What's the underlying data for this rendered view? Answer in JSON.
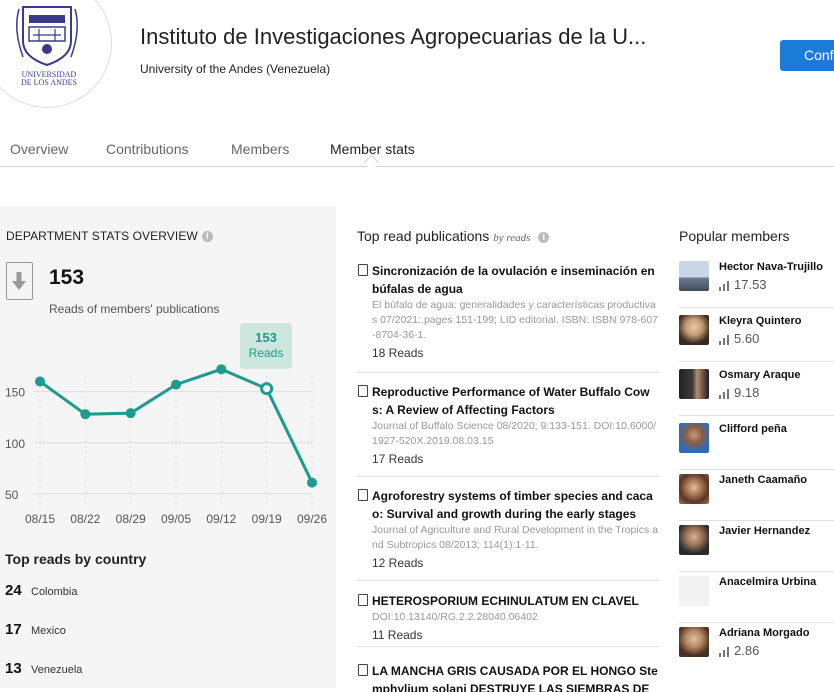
{
  "header": {
    "logo_text": "UNIVERSIDAD DE LOS ANDES",
    "title": "Instituto de Investigaciones Agropecuarias de la U...",
    "subtitle": "University of the Andes (Venezuela)",
    "follow_label": "Conf"
  },
  "tabs": [
    {
      "label": "Overview"
    },
    {
      "label": "Contributions"
    },
    {
      "label": "Members"
    },
    {
      "label": "Member stats"
    }
  ],
  "stats": {
    "section_label": "DEPARTMENT STATS OVERVIEW",
    "reads_value": "153",
    "reads_caption": "Reads of members' publications",
    "tooltip_value": "153",
    "tooltip_label": "Reads"
  },
  "chart_data": {
    "type": "line",
    "x": [
      "08/15",
      "08/22",
      "08/29",
      "09/05",
      "09/12",
      "09/19",
      "09/26"
    ],
    "values": [
      160,
      128,
      129,
      157,
      172,
      153,
      61
    ],
    "ylim": [
      40,
      185
    ],
    "yticks": [
      50,
      100,
      150
    ],
    "highlight_index": 5,
    "color": "#1b9c8d"
  },
  "countries": {
    "title": "Top reads by country",
    "items": [
      {
        "count": "24",
        "name": "Colombia"
      },
      {
        "count": "17",
        "name": "Mexico"
      },
      {
        "count": "13",
        "name": "Venezuela"
      }
    ]
  },
  "publications": {
    "title": "Top read publications",
    "by": "by reads",
    "items": [
      {
        "title": "Sincronización de la ovulación e inseminación en búfalas de agua",
        "meta": "El búfalo de agua: generalidades y características productivas 07/2021: pages 151-199; LID editorial. ISBN: ISBN 978-607-8704-36-1.",
        "reads": "18 Reads"
      },
      {
        "title": "Reproductive Performance of Water Buffalo Cows: A Review of Affecting Factors",
        "meta": "Journal of Buffalo Science 08/2020; 9:133-151. DOI:10.6000/1927-520X.2019.08.03.15",
        "reads": "17 Reads"
      },
      {
        "title": "Agroforestry systems of timber species and cacao: Survival and growth during the early stages",
        "meta": "Journal of Agriculture and Rural Development in the Tropics and Subtropics 08/2013; 114(1):1-11.",
        "reads": "12 Reads"
      },
      {
        "title": "HETEROSPORIUM ECHINULATUM EN CLAVEL",
        "meta": "DOI:10.13140/RG.2.2.28040.06402",
        "reads": "11 Reads"
      },
      {
        "title": "LA MANCHA GRIS CAUSADA POR EL HONGO Stemphylium solani DESTRUYE LAS SIEMBRAS DE TOMAT",
        "meta": "",
        "reads": ""
      }
    ]
  },
  "members": {
    "title": "Popular members",
    "items": [
      {
        "name": "Hector Nava-Trujillo",
        "score": "17.53"
      },
      {
        "name": "Kleyra Quintero",
        "score": "5.60"
      },
      {
        "name": "Osmary Araque",
        "score": "9.18"
      },
      {
        "name": "Clifford peña",
        "score": ""
      },
      {
        "name": "Janeth Caamaño",
        "score": ""
      },
      {
        "name": "Javier Hernandez",
        "score": ""
      },
      {
        "name": "Anacelmira Urbina",
        "score": ""
      },
      {
        "name": "Adriana Morgado",
        "score": "2.86"
      }
    ]
  }
}
